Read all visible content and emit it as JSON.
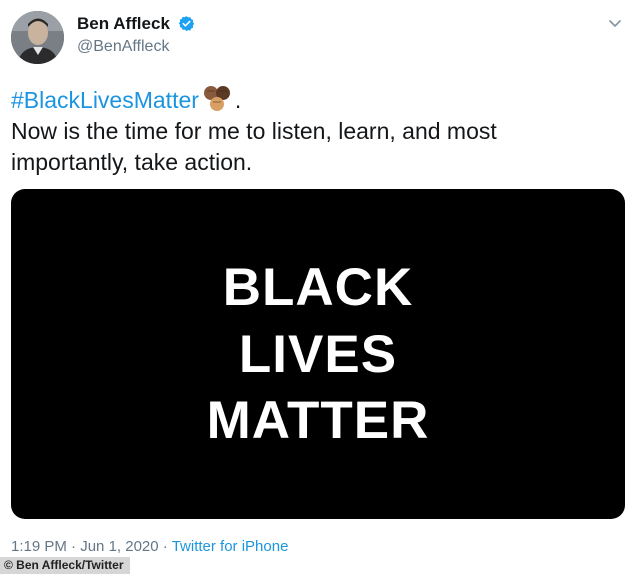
{
  "author": {
    "display_name": "Ben Affleck",
    "handle": "@BenAffleck",
    "verified": true,
    "verified_color": "#1da1f2"
  },
  "icons": {
    "avatar": "avatar-photo",
    "verified": "verified-badge-icon",
    "menu": "chevron-down-icon",
    "emoji": "raised-fists-emoji-icon"
  },
  "tweet": {
    "hashtag": "#BlackLivesMatter",
    "after_emoji": ".",
    "body": "Now is the time for me to listen, learn, and most importantly, take action."
  },
  "media": {
    "line1": "BLACK",
    "line2": "LIVES",
    "line3": "MATTER"
  },
  "meta": {
    "time": "1:19 PM",
    "separator1": " · ",
    "date": "Jun 1, 2020",
    "separator2": " · ",
    "source": "Twitter for iPhone"
  },
  "credit": "© Ben Affleck/Twitter",
  "colors": {
    "link": "#1b95e0",
    "secondary_text": "#657786",
    "primary_text": "#14171a"
  }
}
